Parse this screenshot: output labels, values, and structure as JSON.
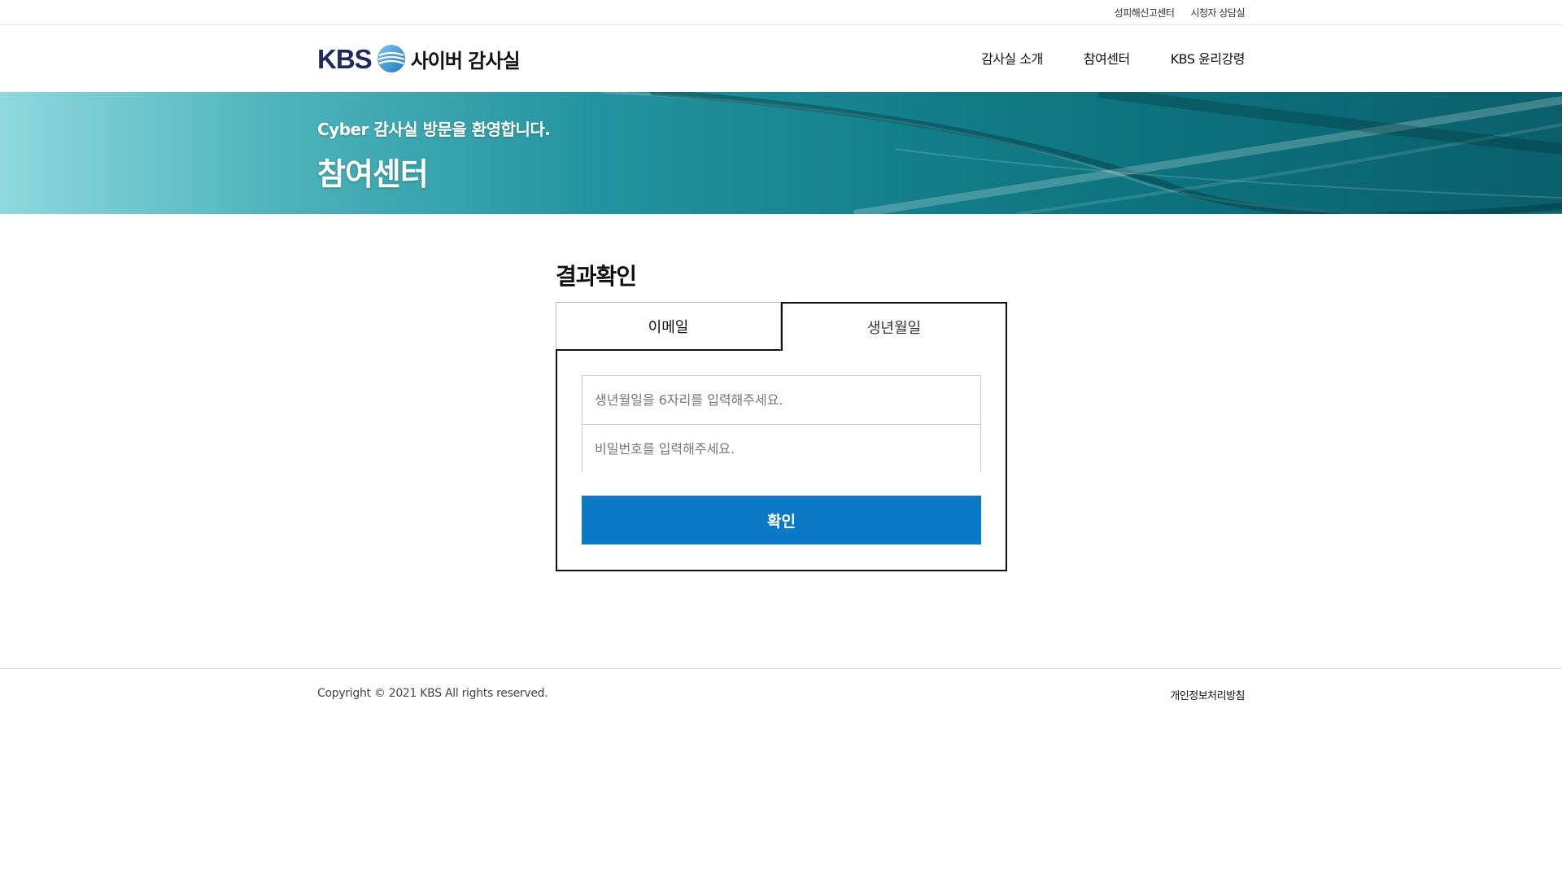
{
  "util_links": [
    "성피해신고센터",
    "시청자 상담실"
  ],
  "header": {
    "logo_kbs": "KBS",
    "logo_text": "사이버 감사실",
    "nav": [
      "감사실 소개",
      "참여센터",
      "KBS 윤리강령"
    ]
  },
  "hero": {
    "subtitle": "Cyber 감사실 방문을 환영합니다.",
    "title": "참여센터"
  },
  "main": {
    "title": "결과확인",
    "tabs": [
      {
        "label": "이메일",
        "active": false
      },
      {
        "label": "생년월일",
        "active": true
      }
    ],
    "birth_placeholder": "생년월일을 6자리를 입력해주세요.",
    "password_placeholder": "비밀번호를 입력해주세요.",
    "confirm_label": "확인"
  },
  "footer": {
    "copyright": "Copyright © 2021 KBS All rights reserved.",
    "privacy": "개인정보처리방침"
  },
  "colors": {
    "accent": "#0b79c6",
    "brand_navy": "#1f2a5e",
    "hero_teal": "#127d88"
  }
}
